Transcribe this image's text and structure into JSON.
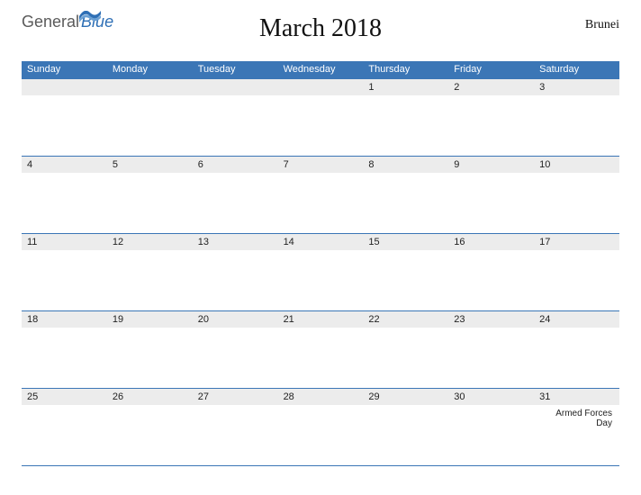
{
  "brand": {
    "part1": "General",
    "part2": "Blue"
  },
  "title": "March 2018",
  "region": "Brunei",
  "days_of_week": [
    "Sunday",
    "Monday",
    "Tuesday",
    "Wednesday",
    "Thursday",
    "Friday",
    "Saturday"
  ],
  "weeks": [
    [
      {
        "n": ""
      },
      {
        "n": ""
      },
      {
        "n": ""
      },
      {
        "n": ""
      },
      {
        "n": "1"
      },
      {
        "n": "2"
      },
      {
        "n": "3"
      }
    ],
    [
      {
        "n": "4"
      },
      {
        "n": "5"
      },
      {
        "n": "6"
      },
      {
        "n": "7"
      },
      {
        "n": "8"
      },
      {
        "n": "9"
      },
      {
        "n": "10"
      }
    ],
    [
      {
        "n": "11"
      },
      {
        "n": "12"
      },
      {
        "n": "13"
      },
      {
        "n": "14"
      },
      {
        "n": "15"
      },
      {
        "n": "16"
      },
      {
        "n": "17"
      }
    ],
    [
      {
        "n": "18"
      },
      {
        "n": "19"
      },
      {
        "n": "20"
      },
      {
        "n": "21"
      },
      {
        "n": "22"
      },
      {
        "n": "23"
      },
      {
        "n": "24"
      }
    ],
    [
      {
        "n": "25"
      },
      {
        "n": "26"
      },
      {
        "n": "27"
      },
      {
        "n": "28"
      },
      {
        "n": "29"
      },
      {
        "n": "30"
      },
      {
        "n": "31",
        "event": "Armed Forces Day"
      }
    ]
  ]
}
